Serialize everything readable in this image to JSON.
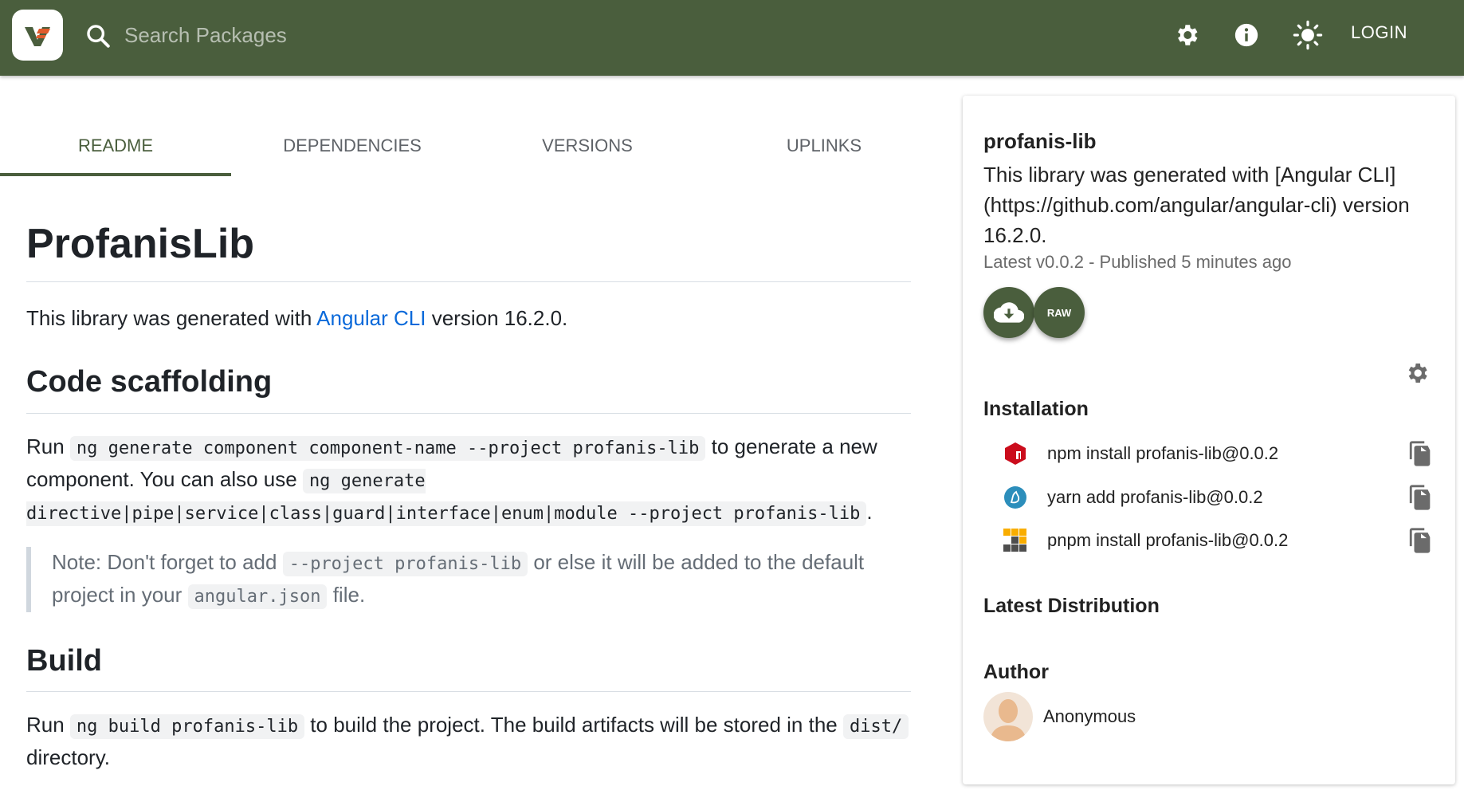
{
  "header": {
    "search_placeholder": "Search Packages",
    "login_label": "LOGIN",
    "accent_color": "#4a5e3d",
    "icons": [
      "search-icon",
      "settings-icon",
      "info-icon",
      "theme-toggle-icon"
    ]
  },
  "tabs": [
    {
      "label": "README",
      "active": true
    },
    {
      "label": "DEPENDENCIES",
      "active": false
    },
    {
      "label": "VERSIONS",
      "active": false
    },
    {
      "label": "UPLINKS",
      "active": false
    }
  ],
  "readme": {
    "title": "ProfanisLib",
    "intro_pre": "This library was generated with ",
    "intro_link": "Angular CLI",
    "intro_post": " version 16.2.0.",
    "scaffold_heading": "Code scaffolding",
    "scaffold_p1": "Run ",
    "scaffold_code1": "ng generate component component-name --project profanis-lib",
    "scaffold_p2": " to generate a new component. You can also use ",
    "scaffold_code2": "ng generate directive|pipe|service|class|guard|interface|enum|module --project profanis-lib",
    "scaffold_p3": ".",
    "note_p1": "Note: Don't forget to add ",
    "note_code1": "--project profanis-lib",
    "note_p2": " or else it will be added to the default project in your ",
    "note_code2": "angular.json",
    "note_p3": " file.",
    "build_heading": "Build",
    "build_p1": "Run ",
    "build_code1": "ng build profanis-lib",
    "build_p2": " to build the project. The build artifacts will be stored in the ",
    "build_code2": "dist/",
    "build_p3": " directory."
  },
  "sidebar": {
    "package_name": "profanis-lib",
    "description": "This library was generated with [Angular CLI](https://github.com/angular/angular-cli) version 16.2.0.",
    "meta": "Latest v0.0.2 - Published 5 minutes ago",
    "raw_label": "RAW",
    "installation_title": "Installation",
    "install": [
      {
        "tool": "npm",
        "command": "npm install profanis-lib@0.0.2"
      },
      {
        "tool": "yarn",
        "command": "yarn add profanis-lib@0.0.2"
      },
      {
        "tool": "pnpm",
        "command": "pnpm install profanis-lib@0.0.2"
      }
    ],
    "distribution_title": "Latest Distribution",
    "author_title": "Author",
    "author_name": "Anonymous"
  }
}
